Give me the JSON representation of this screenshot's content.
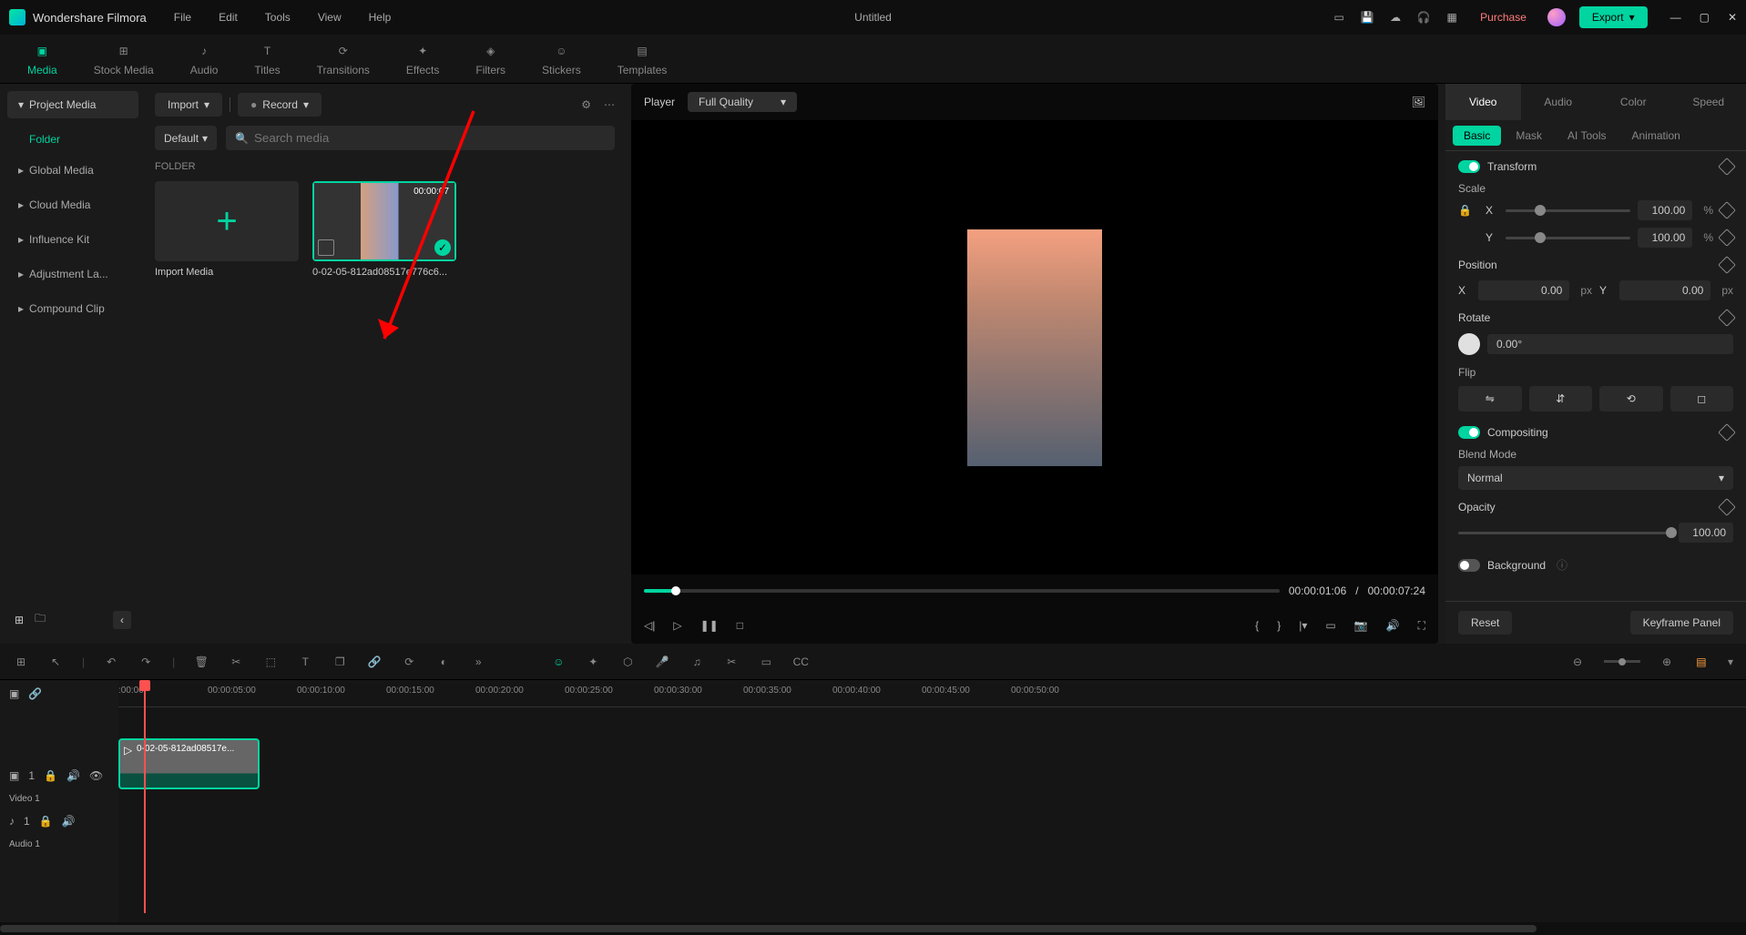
{
  "app": {
    "name": "Wondershare Filmora",
    "title": "Untitled"
  },
  "menu": {
    "file": "File",
    "edit": "Edit",
    "tools": "Tools",
    "view": "View",
    "help": "Help"
  },
  "header": {
    "purchase": "Purchase",
    "export": "Export"
  },
  "ribbon": {
    "media": "Media",
    "stock": "Stock Media",
    "audio": "Audio",
    "titles": "Titles",
    "transitions": "Transitions",
    "effects": "Effects",
    "filters": "Filters",
    "stickers": "Stickers",
    "templates": "Templates"
  },
  "sidebar": {
    "project": "Project Media",
    "folder": "Folder",
    "global": "Global Media",
    "cloud": "Cloud Media",
    "influence": "Influence Kit",
    "adjustment": "Adjustment La...",
    "compound": "Compound Clip"
  },
  "mediaPanel": {
    "import": "Import",
    "record": "Record",
    "default": "Default",
    "searchPlaceholder": "Search media",
    "folderHead": "FOLDER",
    "importMedia": "Import Media",
    "clipDuration": "00:00:07",
    "clipName": "0-02-05-812ad08517e776c6..."
  },
  "player": {
    "label": "Player",
    "quality": "Full Quality",
    "time": "00:00:01:06",
    "sep": "/",
    "dur": "00:00:07:24"
  },
  "inspector": {
    "tabs": {
      "video": "Video",
      "audio": "Audio",
      "color": "Color",
      "speed": "Speed"
    },
    "sub": {
      "basic": "Basic",
      "mask": "Mask",
      "ai": "AI Tools",
      "anim": "Animation"
    },
    "transform": "Transform",
    "scale": "Scale",
    "x": "X",
    "y": "Y",
    "scaleX": "100.00",
    "scaleY": "100.00",
    "pct": "%",
    "position": "Position",
    "posX": "0.00",
    "posY": "0.00",
    "px": "px",
    "rotate": "Rotate",
    "rotVal": "0.00°",
    "flip": "Flip",
    "compositing": "Compositing",
    "blend": "Blend Mode",
    "blendVal": "Normal",
    "opacity": "Opacity",
    "opVal": "100.00",
    "background": "Background",
    "reset": "Reset",
    "keyframe": "Keyframe Panel"
  },
  "timeline": {
    "ticks": [
      ":00:00",
      "00:00:05:00",
      "00:00:10:00",
      "00:00:15:00",
      "00:00:20:00",
      "00:00:25:00",
      "00:00:30:00",
      "00:00:35:00",
      "00:00:40:00",
      "00:00:45:00",
      "00:00:50:00"
    ],
    "video": "Video 1",
    "audio": "Audio 1",
    "v1": "1",
    "a1": "1",
    "clipLabel": "0-02-05-812ad08517e..."
  }
}
